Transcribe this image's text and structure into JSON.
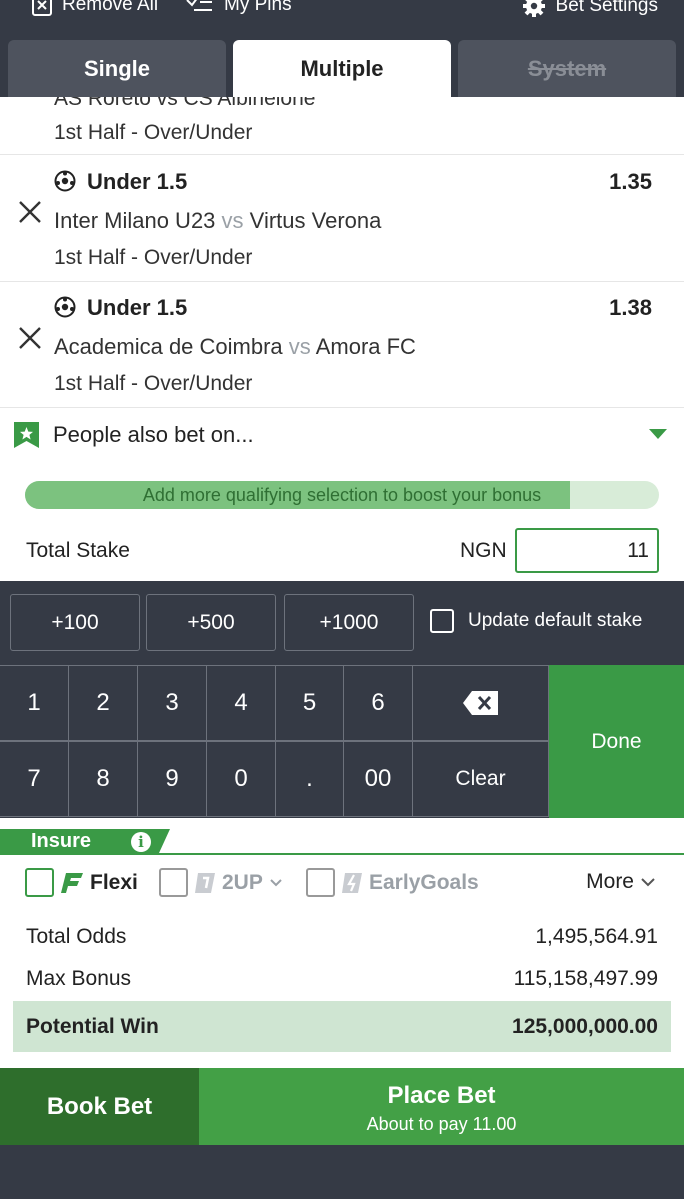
{
  "topbar": {
    "remove_all": "Remove All",
    "my_pins": "My Pins",
    "bet_settings": "Bet Settings"
  },
  "tabs": [
    {
      "label": "Single",
      "state": "inactive"
    },
    {
      "label": "Multiple",
      "state": "active"
    },
    {
      "label": "System",
      "state": "disabled"
    }
  ],
  "partial_bet": {
    "match": "AS Roreto vs CS Albineione",
    "market": "1st Half - Over/Under"
  },
  "bets": [
    {
      "pick": "Under 1.5",
      "odds": "1.35",
      "home": "Inter Milano U23",
      "vs": "vs",
      "away": "Virtus Verona",
      "market": "1st Half - Over/Under"
    },
    {
      "pick": "Under 1.5",
      "odds": "1.38",
      "home": "Academica de Coimbra",
      "vs": "vs",
      "away": "Amora FC",
      "market": "1st Half - Over/Under"
    }
  ],
  "people_also_bet": "People also bet on...",
  "bonus_bar": {
    "text": "Add more qualifying selection to boost your bonus",
    "progress": 0.86
  },
  "stake": {
    "label": "Total Stake",
    "currency": "NGN",
    "value": "11"
  },
  "quick_stakes": [
    "+100",
    "+500",
    "+1000"
  ],
  "update_default_stake": "Update default stake",
  "keypad": {
    "row1": [
      "1",
      "2",
      "3",
      "4",
      "5",
      "6"
    ],
    "row2": [
      "7",
      "8",
      "9",
      "0",
      ".",
      "00"
    ],
    "clear": "Clear",
    "done": "Done"
  },
  "insure": {
    "label": "Insure",
    "info": "i"
  },
  "options": {
    "flexi": "Flexi",
    "two_up": "2UP",
    "early_goals": "EarlyGoals",
    "more": "More"
  },
  "summary": {
    "total_odds_label": "Total Odds",
    "total_odds": "1,495,564.91",
    "max_bonus_label": "Max Bonus",
    "max_bonus": "115,158,497.99",
    "potential_win_label": "Potential Win",
    "potential_win": "125,000,000.00"
  },
  "actions": {
    "book_bet": "Book Bet",
    "place_bet": "Place Bet",
    "about_to_pay": "About to pay 11.00"
  },
  "colors": {
    "brand_green": "#3a9a46",
    "dark_bg": "#353a45",
    "book_green": "#2e6e2c"
  }
}
